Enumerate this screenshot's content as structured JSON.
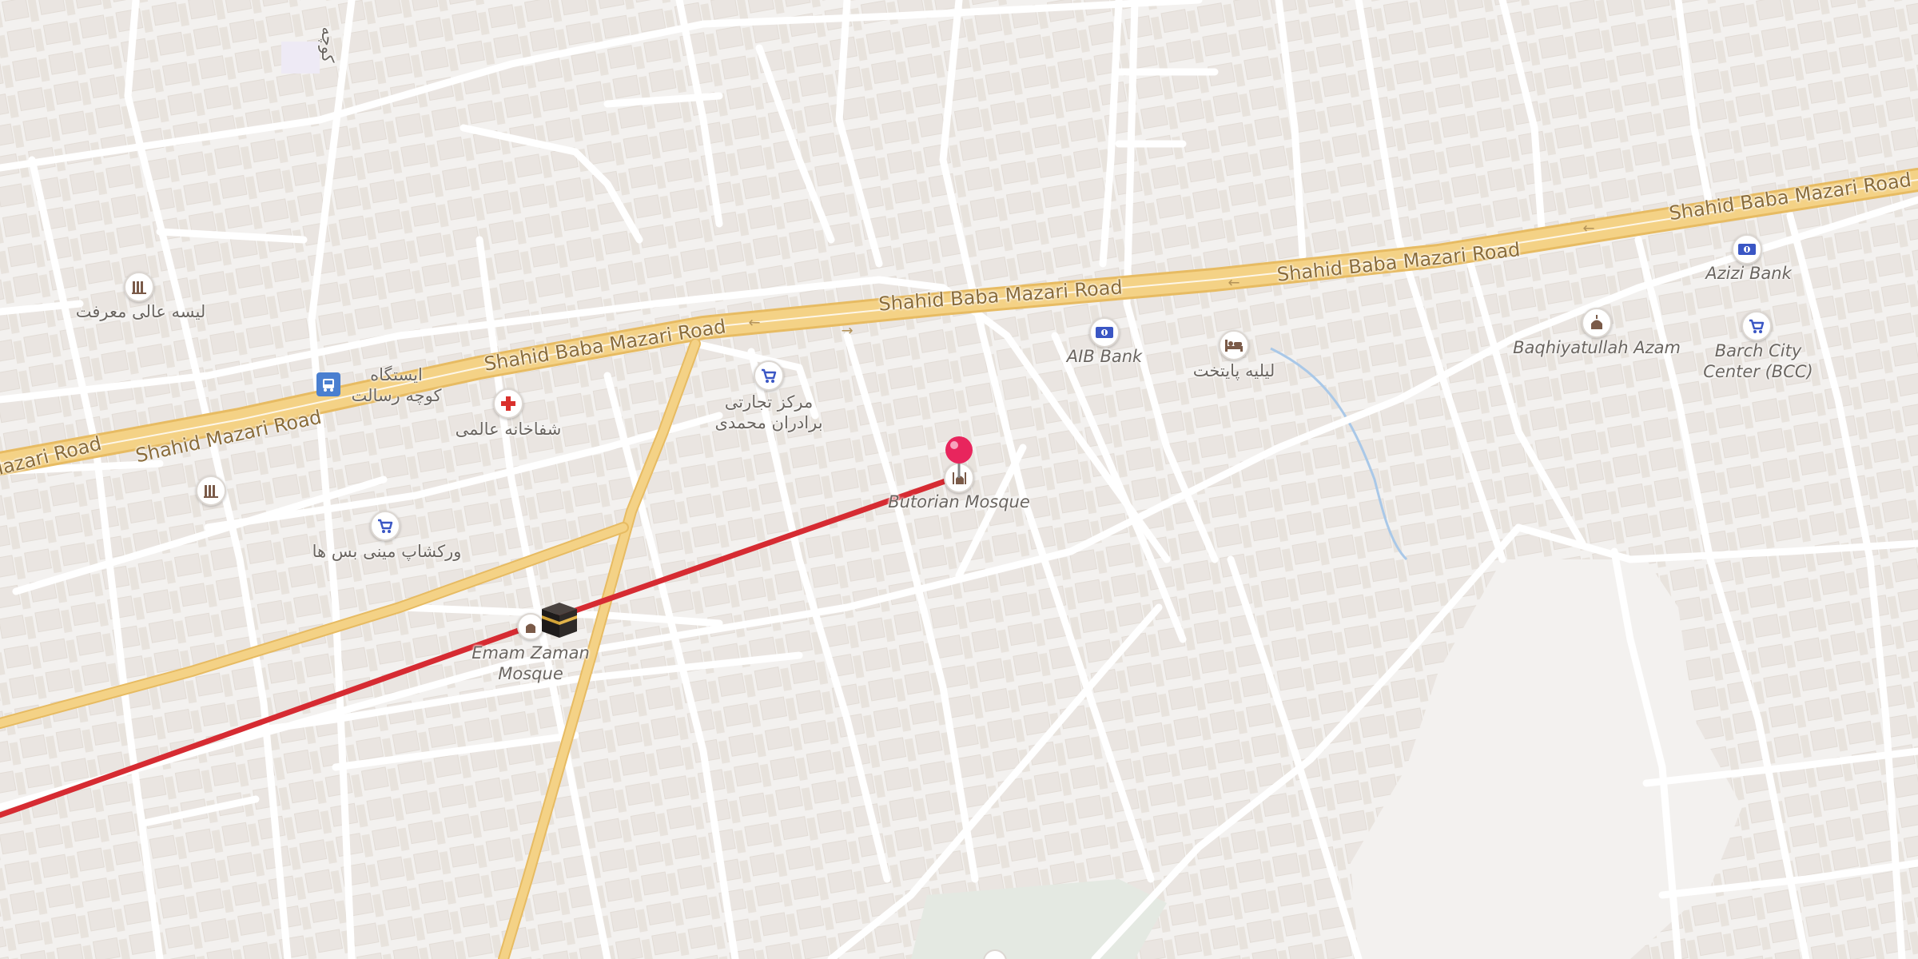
{
  "map": {
    "colors": {
      "background": "#f3f1ef",
      "building": "#e8e3de",
      "street": "#ffffff",
      "main_road": "#f4d286",
      "main_road_casing": "#e7bb62",
      "route": "#d62b32",
      "water": "#a9c8e8",
      "park": "#e4e9e2",
      "pin": "#e8255d"
    },
    "road_labels": [
      "Shahid Baba Mazari Road",
      "Shahid Baba Mazari Road",
      "Shahid Baba Mazari Road",
      "Shahid Baba Mazari Road",
      "Shahid Mazari Road",
      "Mazari Road",
      "کوچه"
    ],
    "places": {
      "library_1": {
        "name": "لیسه عالی معرفت",
        "icon": "library-icon"
      },
      "library_2": {
        "name": "",
        "icon": "library-icon"
      },
      "bus_stop": {
        "name": "ایستگاه\nکوچه رسالت",
        "icon": "bus-stop-icon"
      },
      "hospital": {
        "name": "شفاخانه عالمی",
        "icon": "hospital-icon"
      },
      "shop_1": {
        "name": "مرکز تجارتی\nبرادران محمدی",
        "icon": "shopping-cart-icon"
      },
      "shop_2": {
        "name": "ورکشاپ مینی بس ها",
        "icon": "shopping-cart-icon"
      },
      "mosque_1": {
        "name": "Emam Zaman\nMosque",
        "icon": "kaaba-icon"
      },
      "mosque_2": {
        "name": "Butorian Mosque",
        "icon": "mosque-icon"
      },
      "bank_1": {
        "name": "AIB Bank",
        "icon": "bank-icon"
      },
      "hotel": {
        "name": "لیلیه پایتخت",
        "icon": "bed-icon"
      },
      "mosque_3": {
        "name": "Baqhiyatullah Azam",
        "icon": "mosque-icon"
      },
      "bank_2": {
        "name": "Azizi Bank",
        "icon": "bank-icon"
      },
      "shop_3": {
        "name": "Barch City\nCenter (BCC)",
        "icon": "shopping-cart-icon"
      }
    },
    "selected_pin": {
      "icon": "location-pin-icon",
      "place": "Butorian Mosque"
    }
  }
}
